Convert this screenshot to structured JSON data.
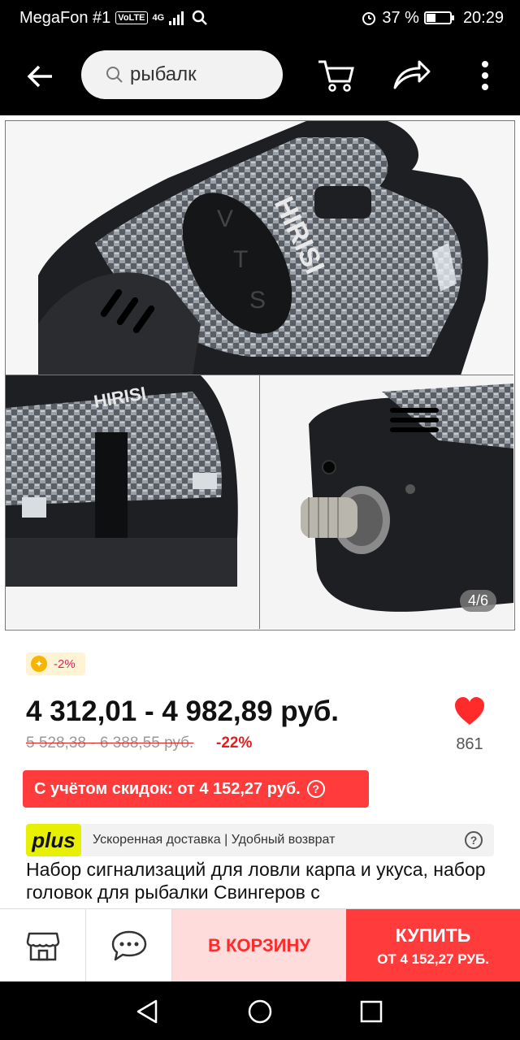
{
  "status_bar": {
    "carrier": "MegaFon #1",
    "volte": "VoLTE",
    "network": "4G",
    "battery_percent": "37 %",
    "battery_level": 0.37,
    "time": "20:29"
  },
  "header": {
    "search_text": "рыбалк",
    "icons": [
      "back-arrow-icon",
      "search-icon",
      "cart-icon",
      "share-icon",
      "more-icon"
    ]
  },
  "gallery": {
    "counter": "4/6",
    "product_logo": "HIRISI",
    "button_letters": [
      "V",
      "T",
      "S"
    ]
  },
  "product": {
    "promo_badge": "-2%",
    "price_range": "4 312,01 - 4 982,89 руб.",
    "old_price_range": "5 528,38 - 6 388,55 руб.",
    "discount_percent": "-22%",
    "likes": "861",
    "discount_banner": "С учётом скидок: от 4 152,27 руб.",
    "plus_label": "plus",
    "plus_text": "Ускоренная доставка | Удобный возврат",
    "title": "Набор сигнализаций для ловли карпа и укуса, набор головок для рыбалки Свингеров с"
  },
  "actions": {
    "add_to_cart": "В КОРЗИНУ",
    "buy": "КУПИТЬ",
    "buy_price": "ОТ 4 152,27 РУБ."
  },
  "colors": {
    "accent_red": "#ff3b3b",
    "plus_yellow": "#e6f000",
    "cart_bg": "#ffdcdc"
  }
}
